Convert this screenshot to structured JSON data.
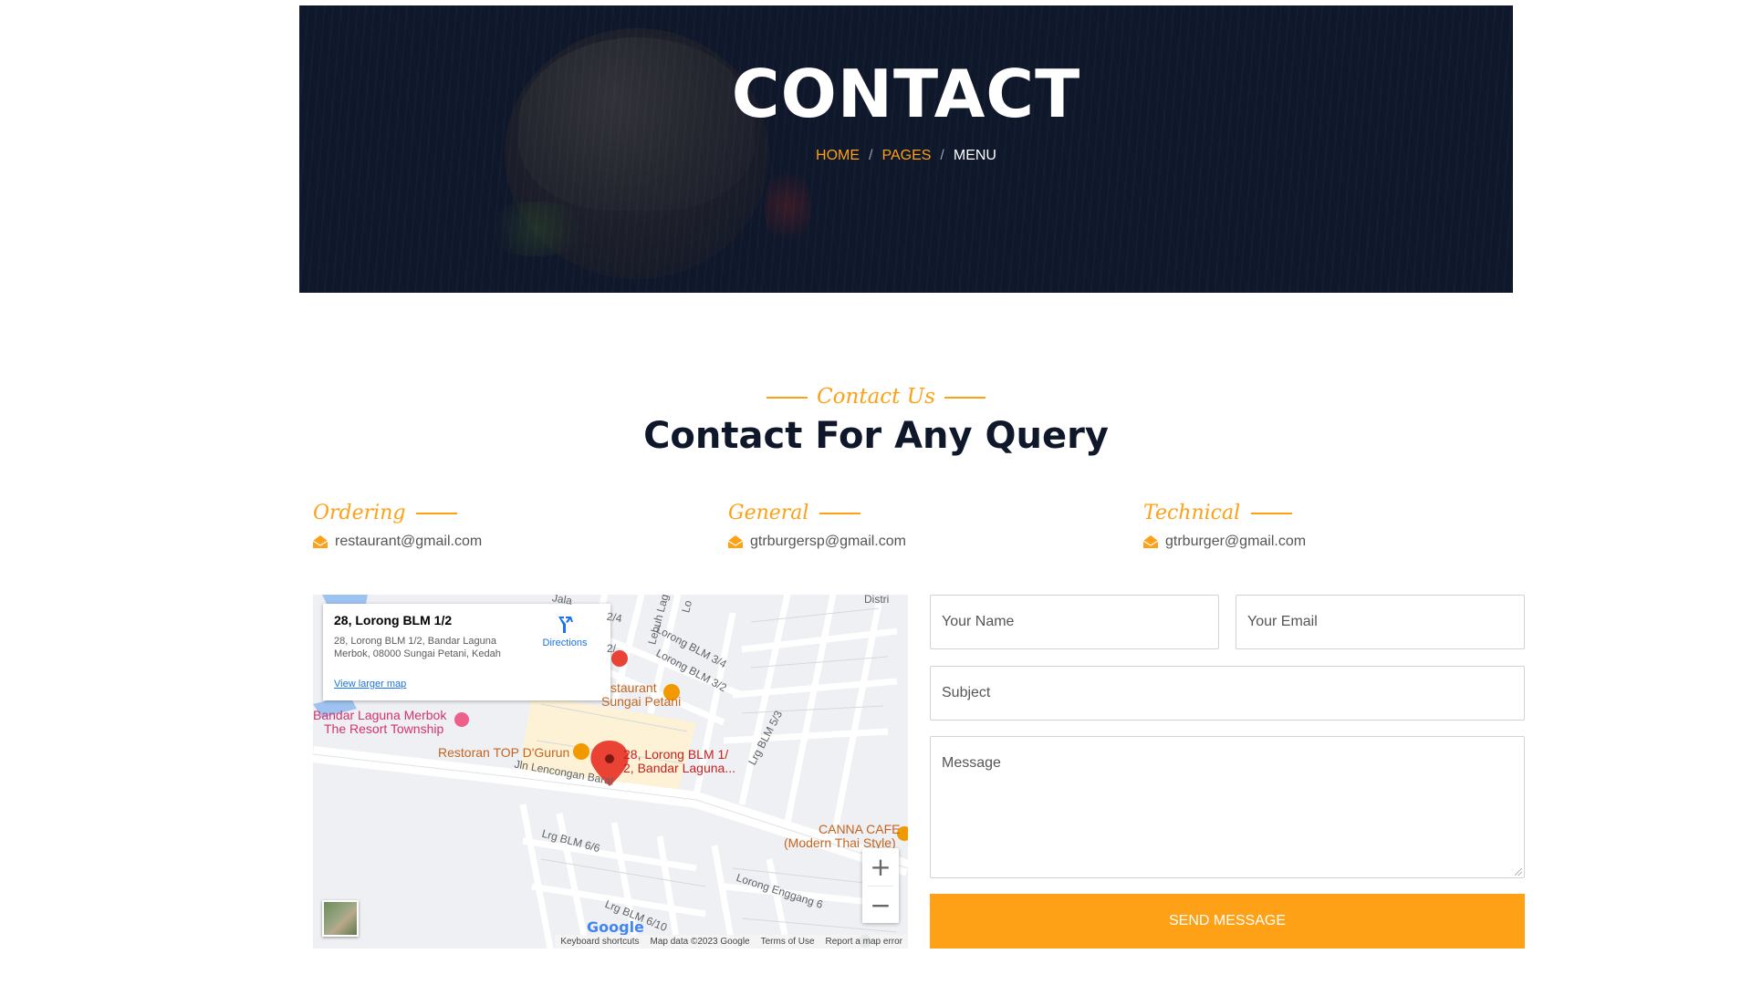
{
  "hero": {
    "title": "CONTACT",
    "breadcrumb": [
      "HOME",
      "PAGES",
      "MENU"
    ],
    "breadcrumb_separator": "/"
  },
  "section": {
    "eyebrow": "Contact Us",
    "title": "Contact For Any Query"
  },
  "contacts": [
    {
      "label": "Ordering",
      "email": "restaurant@gmail.com"
    },
    {
      "label": "General",
      "email": "gtrburgersp@gmail.com"
    },
    {
      "label": "Technical",
      "email": "gtrburger@gmail.com"
    }
  ],
  "map": {
    "card_title": "28, Lorong BLM 1/2",
    "card_address": "28, Lorong BLM 1/2, Bandar Laguna Merbok, 08000 Sungai Petani, Kedah",
    "directions": "Directions",
    "view_larger": "View larger map",
    "places": {
      "marker": "28, Lorong BLM 1/ 2, Bandar Laguna...",
      "resort_1": "Bandar Laguna Merbok",
      "resort_2": "The Resort Township",
      "restoran": "Restoran TOP D'Gurun",
      "cafe_1": "CANNA CAFE",
      "cafe_2": "(Modern Thai Style)",
      "restaurant_1": "staurant",
      "restaurant_2": "Sungai Petani",
      "distri": "Distri"
    },
    "streets": {
      "jln": "Jln Lencongan Barat",
      "blm34": "Lorong BLM 3/4",
      "blm32": "Lorong BLM 3/2",
      "blm53": "Lrg BLM 5/3",
      "blm66": "Lrg BLM 6/6",
      "enggang": "Lorong Enggang 6",
      "blm610": "Lrg BLM 6/10",
      "lebuh": "Lebuh Lag",
      "lo": "Lo",
      "jala": "Jala",
      "n24": "2/4",
      "n2": "2/"
    },
    "zoom_in": "+",
    "zoom_out": "−",
    "google": "Google",
    "footer": [
      "Keyboard shortcuts",
      "Map data ©2023 Google",
      "Terms of Use",
      "Report a map error"
    ]
  },
  "form": {
    "name_placeholder": "Your Name",
    "email_placeholder": "Your Email",
    "subject_placeholder": "Subject",
    "message_placeholder": "Message",
    "submit_label": "SEND MESSAGE"
  },
  "colors": {
    "accent": "#fea116",
    "dark": "#0f172b",
    "text": "#555555"
  },
  "icons": {
    "email": "envelope-open-icon",
    "directions": "directions-icon",
    "marker": "map-pin-icon"
  }
}
